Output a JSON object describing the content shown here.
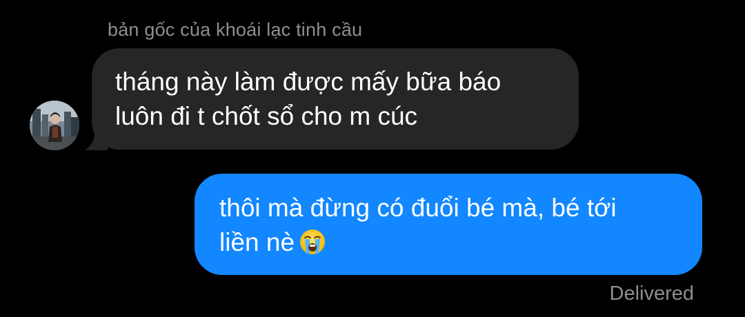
{
  "thread": {
    "sender_name": "bản gốc của khoái lạc tinh cầu"
  },
  "messages": [
    {
      "direction": "incoming",
      "lines": [
        "tháng này làm được mấy bữa báo",
        "luôn đi t chốt sổ cho m cúc"
      ],
      "avatar_icon": "user-photo-avatar"
    },
    {
      "direction": "outgoing",
      "lines": [
        "thôi mà đừng có đuổi bé mà, bé tới",
        "liền nè"
      ],
      "emoji": "loudly-crying-face-emoji",
      "status": "Delivered"
    }
  ],
  "colors": {
    "background": "#000000",
    "incoming_bubble": "#262629",
    "outgoing_bubble": "#1287ff",
    "meta_text": "#8e8e93"
  }
}
